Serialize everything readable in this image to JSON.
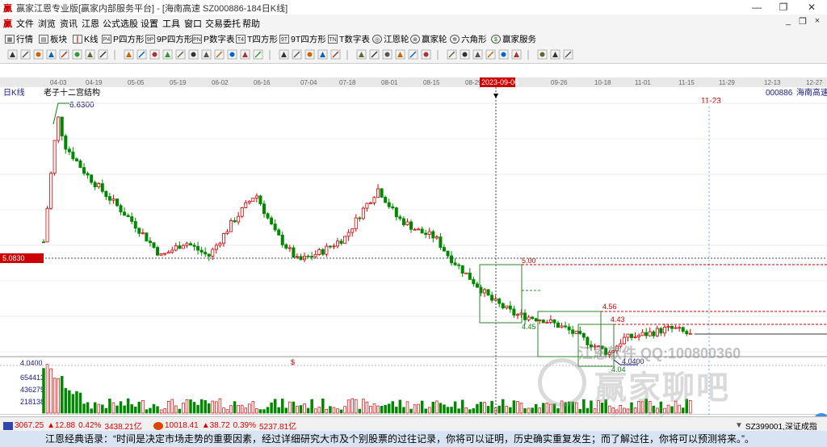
{
  "window": {
    "title": "赢家江恩专业版[赢家内部服务平台] - [海南高速  SZ000886-184日K线]",
    "minimize": "—",
    "restore": "❐",
    "close": "✕",
    "logo": "贏"
  },
  "menu": {
    "logo": "贏",
    "items": [
      "文件",
      "浏览",
      "资讯",
      "江恩",
      "公式选股",
      "设置",
      "工具",
      "窗口",
      "交易委托",
      "帮助"
    ],
    "mdi": [
      "_",
      "❐",
      "×"
    ]
  },
  "toolbar1": {
    "items": [
      {
        "icon": "grid",
        "label": "行情"
      },
      {
        "icon": "block",
        "label": "板块"
      },
      {
        "icon": "candle",
        "label": "K线"
      },
      {
        "icon": "P4",
        "label": "P四方形"
      },
      {
        "icon": "9P",
        "label": "9P四方形"
      },
      {
        "icon": "PN",
        "label": "P数字表"
      },
      {
        "icon": "T4",
        "label": "T四方形"
      },
      {
        "icon": "9T",
        "label": "9T四方形"
      },
      {
        "icon": "TN",
        "label": "T数字表"
      },
      {
        "icon": "wheel",
        "label": "江恩轮"
      },
      {
        "icon": "wheel2",
        "label": "赢家轮"
      },
      {
        "icon": "hex",
        "label": "六角形"
      },
      {
        "icon": "dollar",
        "label": "赢家服务"
      }
    ]
  },
  "chart": {
    "period_label": "日K线",
    "indicator_title": "老子十二宫结构",
    "stock_code": "000886",
    "stock_name": "海南高速",
    "high_label": "6.6300",
    "low_label": "4.0400",
    "cursor_date": "2023-09-06",
    "cursor_price": "5.0830",
    "future_date": "11-23",
    "level_500": "5.00",
    "level_456": "4.56",
    "level_445": "4.45",
    "level_443": "4.43",
    "level_404": "4.04",
    "dollar_mark": "$",
    "dates": [
      "04-03",
      "04-19",
      "05-05",
      "05-19",
      "06-02",
      "06-16",
      "07-04",
      "07-18",
      "08-01",
      "08-15",
      "08-29",
      "09-26",
      "10-18",
      "11-01",
      "11-15",
      "11-29",
      "12-13",
      "12-27"
    ],
    "vol_labels": [
      "4.0400",
      "654413",
      "436275",
      "218138"
    ]
  },
  "status": {
    "sh_index": "3067.25",
    "sh_change": "▲12.88",
    "sh_pct": "0.42%",
    "sh_amount": "3438.21亿",
    "sz_index": "10018.41",
    "sz_change": "▲38.72",
    "sz_pct": "0.39%",
    "sz_amount": "5237.81亿",
    "right_code": "SZ399001,深证成指"
  },
  "quote": "江恩经典语录：“时间是决定市场走势的重要因素，经过详细研究大市及个别股票的过往记录，你将可以证明，历史确实重复发生；而了解过往，你将可以预测将来。”。",
  "watermark": {
    "software": "江恩软件  QQ:100800360",
    "brand": "赢家聊吧",
    "brand_en": "jiaoba.yxgs"
  },
  "colors": {
    "up": "#d40000",
    "down": "#008800",
    "grid": "#cccccc",
    "axis_text": "#1a1a80",
    "cursor": "#444444",
    "price_tag_bg": "#cc0000"
  }
}
